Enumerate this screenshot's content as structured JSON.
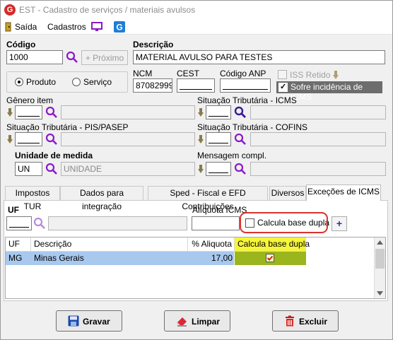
{
  "window": {
    "title": "EST - Cadastro de serviços / materiais avulsos",
    "app_icon_letter": "G"
  },
  "menu": {
    "saida": "Saída",
    "cadastros": "Cadastros"
  },
  "codigo": {
    "label": "Código",
    "value": "1000"
  },
  "proximo": {
    "label": "+ Próximo"
  },
  "descricao": {
    "label": "Descrição",
    "value": "MATERIAL AVULSO PARA TESTES"
  },
  "tipo": {
    "produto": "Produto",
    "servico": "Serviço",
    "selected": "Produto"
  },
  "ncm": {
    "label": "NCM",
    "value": "87082999"
  },
  "cest": {
    "label": "CEST",
    "value": ""
  },
  "anp": {
    "label": "Código ANP",
    "value": ""
  },
  "iss_retido": {
    "label": "ISS Retido",
    "checked": false
  },
  "sofre_icms": {
    "label": "Sofre incidência de ICMS",
    "checked": true
  },
  "genero": {
    "label": "Gênero item"
  },
  "st_icms": {
    "label": "Situação Tributária - ICMS"
  },
  "st_pis": {
    "label": "Situação Tributária - PIS/PASEP"
  },
  "st_cofins": {
    "label": "Situação Tributária - COFINS"
  },
  "unidade": {
    "label": "Unidade de medida",
    "code": "UN",
    "desc": "UNIDADE"
  },
  "mensagem": {
    "label": "Mensagem compl."
  },
  "tabs": [
    {
      "label": "Impostos TUR"
    },
    {
      "label": "Dados para integração"
    },
    {
      "label": "Sped - Fiscal e EFD Contribuições"
    },
    {
      "label": "Diversos"
    },
    {
      "label": "Exceções de ICMS"
    }
  ],
  "active_tab": "Exceções de ICMS",
  "excecoes": {
    "uf_label": "UF",
    "aliquota_label": "Alíquota ICMS",
    "calcula_label": "Calcula base dupla",
    "add_symbol": "+"
  },
  "table": {
    "headers": [
      "UF",
      "Descrição",
      "% Aliquota",
      "Calcula base dupla"
    ],
    "rows": [
      {
        "uf": "MG",
        "descricao": "Minas Gerais",
        "aliquota": "17,00",
        "calcula": true
      }
    ]
  },
  "buttons": {
    "gravar": "Gravar",
    "limpar": "Limpar",
    "excluir": "Excluir"
  },
  "colors": {
    "accent": "#5a2ec4",
    "selected_row": "#a8c8ee",
    "calc_header": "#f5f53a",
    "calc_cell": "#9ab51e",
    "highlight_border": "#d9332b"
  }
}
